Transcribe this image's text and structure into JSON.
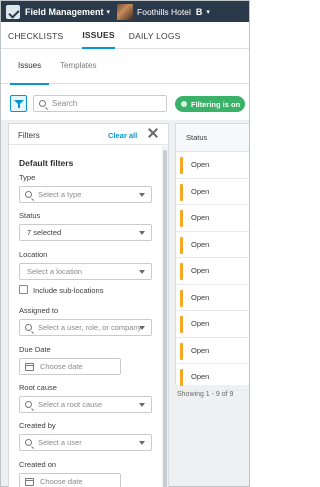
{
  "topbar": {
    "app_name": "Field Management",
    "project_name": "Foothills Hotel",
    "brand_letter": "B",
    "icons": [
      "app-logo-icon",
      "chevron-down-icon"
    ]
  },
  "tabs": [
    {
      "label": "CHECKLISTS",
      "active": false
    },
    {
      "label": "ISSUES",
      "active": true
    },
    {
      "label": "DAILY LOGS",
      "active": false
    }
  ],
  "subtabs": [
    {
      "label": "Issues",
      "active": true
    },
    {
      "label": "Templates",
      "active": false
    }
  ],
  "toolbar": {
    "search_placeholder": "Search",
    "filtering_badge": "Filtering is on",
    "accent_color": "#0696d7",
    "badge_color": "#3bb26a"
  },
  "filters": {
    "title": "Filters",
    "clear_all": "Clear all",
    "default_filters": "Default filters",
    "type": {
      "label": "Type",
      "placeholder": "Select a type"
    },
    "status": {
      "label": "Status",
      "value": "7 selected"
    },
    "location": {
      "label": "Location",
      "placeholder": "Select a location",
      "sub_locations": "Include sub-locations"
    },
    "assigned_to": {
      "label": "Assigned to",
      "placeholder": "Select a user, role, or company"
    },
    "due_date": {
      "label": "Due Date",
      "placeholder": "Choose date"
    },
    "root_cause": {
      "label": "Root cause",
      "placeholder": "Select a root cause"
    },
    "created_by": {
      "label": "Created by",
      "placeholder": "Select a user"
    },
    "created_on": {
      "label": "Created on",
      "placeholder": "Choose date"
    }
  },
  "issues_table": {
    "column_header": "Status",
    "rows": [
      "Open",
      "Open",
      "Open",
      "Open",
      "Open",
      "Open",
      "Open",
      "Open",
      "Open"
    ],
    "status_color": "#f5a623",
    "pagination": "Showing 1 - 9 of 9"
  }
}
